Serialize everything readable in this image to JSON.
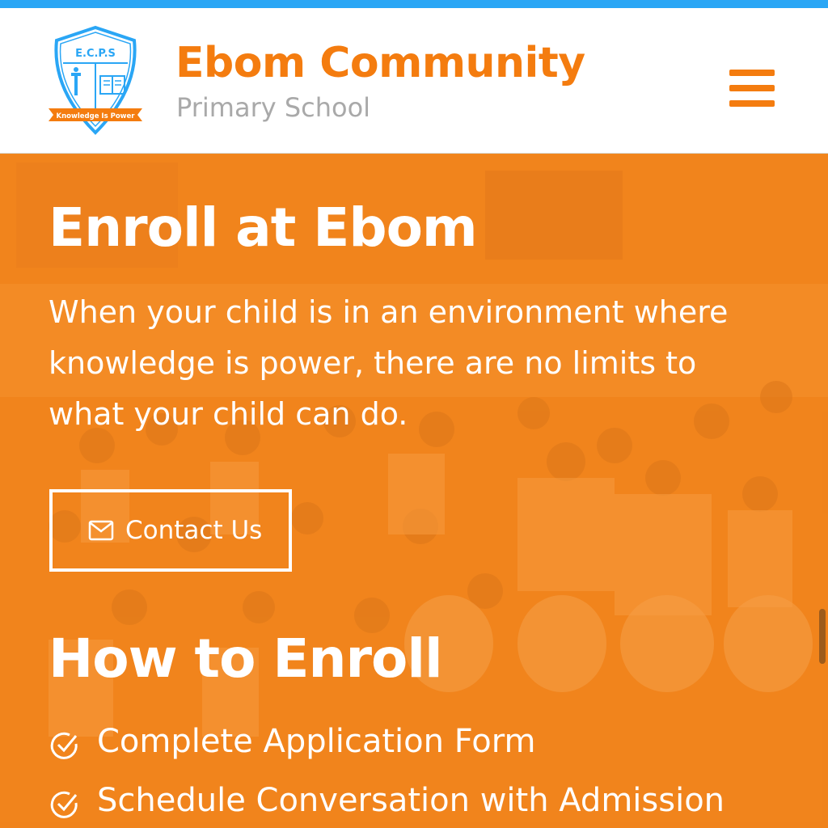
{
  "header": {
    "logo": {
      "top_text": "E.C.P.S",
      "ribbon_text": "Knowledge Is Power"
    },
    "brand_title": "Ebom Community",
    "brand_subtitle": "Primary School",
    "menu_icon": "hamburger-menu-icon"
  },
  "hero": {
    "title": "Enroll at Ebom",
    "text": "When your child is in an environment where knowledge is power, there are no limits to what your child can do.",
    "contact_button": {
      "icon": "envelope-icon",
      "label": "Contact Us"
    },
    "section_title": "How to Enroll",
    "steps": [
      {
        "icon": "check-circle-icon",
        "label": "Complete Application Form"
      },
      {
        "icon": "check-circle-icon",
        "label": "Schedule Conversation with Admission"
      }
    ]
  },
  "colors": {
    "accent": "#f47c0f",
    "top_bar": "#2aa6f5",
    "subtitle_gray": "#a9a9a9",
    "overlay_orange": "#f78618"
  }
}
